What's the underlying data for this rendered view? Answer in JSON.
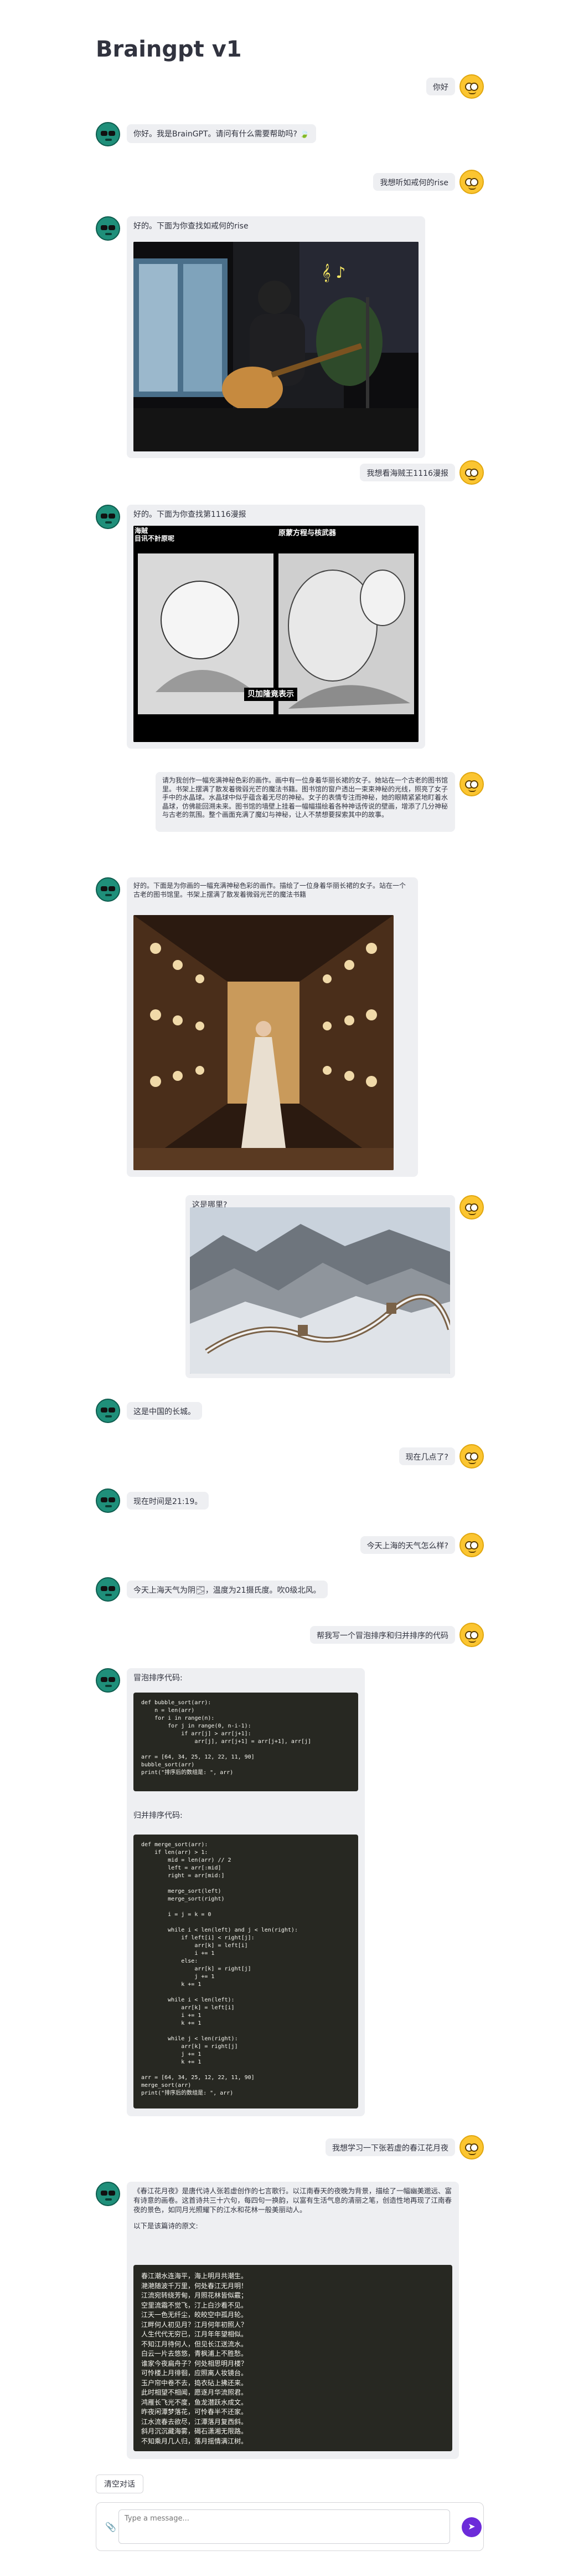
{
  "app": {
    "title": "Braingpt v1"
  },
  "messages": {
    "m1": {
      "role": "user",
      "text": "你好"
    },
    "m2": {
      "role": "assistant",
      "text": "你好。我是BrainGPT。请问有什么需要帮助吗? 🍃"
    },
    "m3": {
      "role": "user",
      "text": "我想听如戒何的rise"
    },
    "m4": {
      "role": "assistant",
      "text": "好的。下面为你查找如戒何的rise"
    },
    "m5": {
      "role": "user",
      "text": "我想看海贼王1116漫报"
    },
    "m6": {
      "role": "assistant",
      "text": "好的。下面为你查找第1116漫报",
      "overlay": {
        "tl": "海賊\n目讯不計原呢",
        "tr": "原蒙方程与核武器",
        "center": "贝加隆竟表示"
      }
    },
    "m7": {
      "role": "user",
      "text": "请为我创作一幅充满神秘色彩的画作。画中有一位身着华丽长裙的女子。她站在一个古老的图书馆里。书架上摆满了散发着微弱光芒的魔法书籍。图书馆的窗户透出一束束神秘的光线，照亮了女子手中的水晶球。水晶球中似乎蕴含着无尽的神秘。女子的表情专注而神秘，她的眼睛紧紧地盯着水晶球，仿佛能回溯未来。图书馆的墙壁上挂着一幅幅描绘着各种神话传说的壁画，增添了几分神秘与古老的氛围。整个画面充满了魔幻与神秘，让人不禁想要探索其中的故事。"
    },
    "m8": {
      "role": "assistant",
      "text": "好的。下面是为你画的一幅充满神秘色彩的画作。描绘了一位身着华丽长裙的女子。站在一个古老的图书馆里。书架上摆满了散发着微弱光芒的魔法书籍"
    },
    "m9": {
      "role": "user",
      "text": "这是哪里?"
    },
    "m10": {
      "role": "assistant",
      "text": "这是中国的长城。"
    },
    "m11": {
      "role": "user",
      "text": "现在几点了?"
    },
    "m12": {
      "role": "assistant",
      "text": "现在时间是21:19。"
    },
    "m13": {
      "role": "user",
      "text": "今天上海的天气怎么样?"
    },
    "m14": {
      "role": "assistant",
      "text": "今天上海天气为阴🌫，温度为21摄氏度。吹0级北风。"
    },
    "m15": {
      "role": "user",
      "text": "帮我写一个冒泡排序和归并排序的代码"
    },
    "m16": {
      "role": "assistant",
      "bubble_title": "冒泡排序代码:",
      "merge_title": "归并排序代码:",
      "bubble_code": [
        "def bubble_sort(arr):",
        "    n = len(arr)",
        "    for i in range(n):",
        "        for j in range(0, n-i-1):",
        "            if arr[j] > arr[j+1]:",
        "                arr[j], arr[j+1] = arr[j+1], arr[j]",
        "",
        "arr = [64, 34, 25, 12, 22, 11, 90]",
        "bubble_sort(arr)",
        "print(\"排序后的数组是: \", arr)"
      ],
      "merge_code": [
        "def merge_sort(arr):",
        "    if len(arr) > 1:",
        "        mid = len(arr) // 2",
        "        left = arr[:mid]",
        "        right = arr[mid:]",
        "",
        "        merge_sort(left)",
        "        merge_sort(right)",
        "",
        "        i = j = k = 0",
        "",
        "        while i < len(left) and j < len(right):",
        "            if left[i] < right[j]:",
        "                arr[k] = left[i]",
        "                i += 1",
        "            else:",
        "                arr[k] = right[j]",
        "                j += 1",
        "            k += 1",
        "",
        "        while i < len(left):",
        "            arr[k] = left[i]",
        "            i += 1",
        "            k += 1",
        "",
        "        while j < len(right):",
        "            arr[k] = right[j]",
        "            j += 1",
        "            k += 1",
        "",
        "arr = [64, 34, 25, 12, 22, 11, 90]",
        "merge_sort(arr)",
        "print(\"排序后的数组是: \", arr)"
      ]
    },
    "m17": {
      "role": "user",
      "text": "我想学习一下张若虚的春江花月夜"
    },
    "m18": {
      "role": "assistant",
      "intro": "《春江花月夜》是唐代诗人张若虚创作的七言歌行。以江南春天的夜晚为背景，描绘了一幅幽美邈远、富有诗意的画卷。这首诗共三十六句，每四句一换韵，以富有生活气息的清丽之笔，创造性地再现了江南春夜的景色，如同月光照耀下的江水和花林一般美丽动人。",
      "poem_label": "以下是该篇诗的原文:",
      "poem": [
        "春江潮水连海平，海上明月共潮生。",
        "滟滟随波千万里，何处春江无月明！",
        "江流宛转绕芳甸，月照花林皆似霰；",
        "空里流霜不觉飞，汀上白沙看不见。",
        "江天一色无纤尘，皎皎空中孤月轮。",
        "江畔何人初见月？江月何年初照人？",
        "人生代代无穷已，江月年年望相似。",
        "不知江月待何人，但见长江送流水。",
        "白云一片去悠悠，青枫浦上不胜愁。",
        "谁家今夜扁舟子？何处相思明月楼？",
        "可怜楼上月徘徊，应照离人妆镜台。",
        "玉户帘中卷不去，捣衣砧上拂还来。",
        "此时相望不相闻，愿逐月华流照君。",
        "鸿雁长飞光不度，鱼龙潜跃水成文。",
        "昨夜闲潭梦落花，可怜春半不还家。",
        "江水流春去欲尽，江潭落月复西斜。",
        "斜月沉沉藏海雾，碣石潇湘无限路。",
        "不知乘月几人归，落月摇情满江树。"
      ]
    }
  },
  "controls": {
    "clear_label": "清空对话",
    "input_placeholder": "Type a message...",
    "attach_icon": "paperclip-icon",
    "send_icon": "send-icon"
  }
}
